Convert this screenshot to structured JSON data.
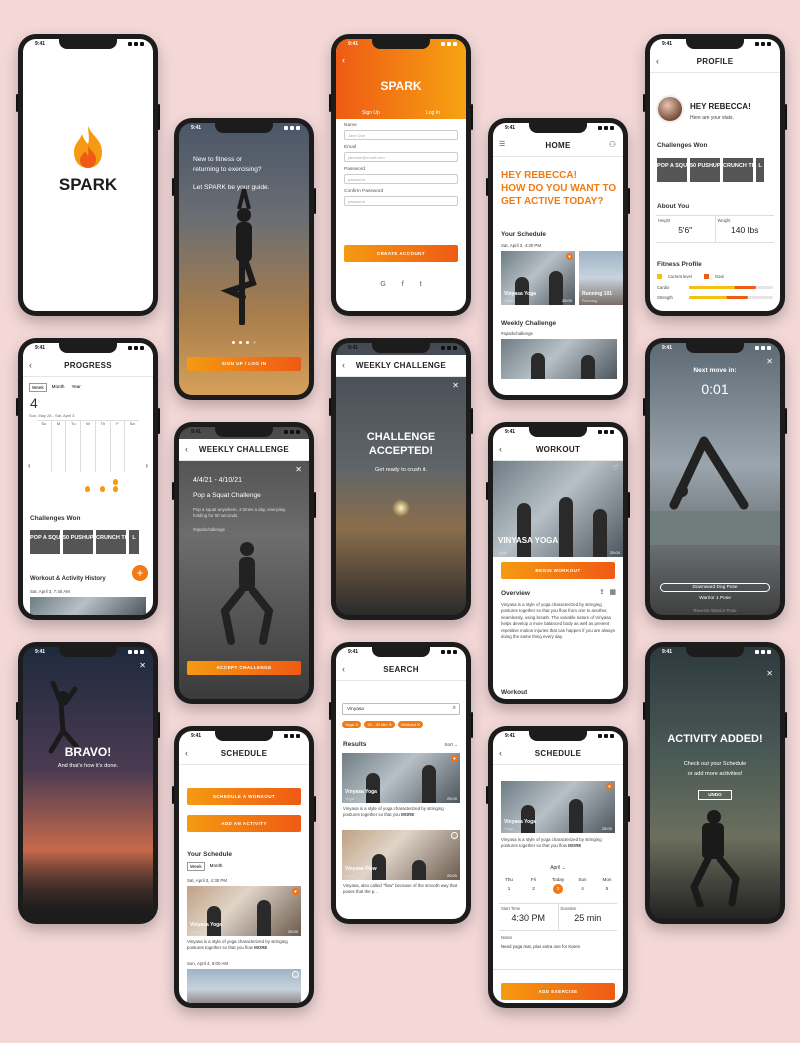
{
  "status_time": "9:41",
  "brand": "SPARK",
  "screens": {
    "splash": {
      "logo": "SPARK"
    },
    "onboarding": {
      "headline1": "New to fitness or",
      "headline2": "returning to exercising?",
      "headline3": "Let SPARK be your guide.",
      "button": "SIGN UP / LOG IN"
    },
    "signup": {
      "title": "SPARK",
      "tab_signup": "Sign Up",
      "tab_login": "Log In",
      "fields": [
        {
          "label": "Name",
          "placeholder": "Jane Doe"
        },
        {
          "label": "Email",
          "placeholder": "janedoe@email.com"
        },
        {
          "label": "Password",
          "placeholder": "password"
        },
        {
          "label": "Confirm Password",
          "placeholder": "password"
        }
      ],
      "button": "CREATE ACCOUNT",
      "social": [
        "G",
        "f",
        "t"
      ]
    },
    "home": {
      "nav_title": "HOME",
      "greeting1": "HEY REBECCA!",
      "greeting2": "HOW DO YOU WANT TO",
      "greeting3": "GET ACTIVE TODAY?",
      "schedule_heading": "Your Schedule",
      "schedule_date": "Sat, April 3, 4:30 PM",
      "card1_title": "Vinyasa Yoga",
      "card1_sub": "Yoga",
      "card1_time": "25:00",
      "card2_title": "Running 101",
      "card2_sub": "Running",
      "weekly_heading": "Weekly Challenge",
      "weekly_tag": "#sparkchallenge"
    },
    "profile": {
      "nav_title": "PROFILE",
      "greeting": "HEY REBECCA!",
      "sub": "Here are your stats.",
      "challenges_heading": "Challenges Won",
      "tiles": [
        "POP A SQUAT",
        "50 PUSHUPS",
        "CRUNCH TIME",
        "L"
      ],
      "about_heading": "About You",
      "height_label": "Height",
      "height_value": "5'6\"",
      "weight_label": "Weight",
      "weight_value": "140 lbs",
      "fitness_heading": "Fitness Profile",
      "legend_current": "Current level",
      "legend_goal": "Goal",
      "bars": [
        {
          "label": "Cardio",
          "current": 0.55,
          "goal": 0.8
        },
        {
          "label": "Strength",
          "current": 0.45,
          "goal": 0.7
        }
      ]
    },
    "progress": {
      "nav_title": "PROGRESS",
      "tabs": [
        "Week",
        "Month",
        "Year"
      ],
      "big_number": "4",
      "range": "Sun, May 28 - Sat, April 3",
      "days": [
        "Su",
        "M",
        "Tu",
        "W",
        "Th",
        "F",
        "Sa"
      ],
      "challenges_heading": "Challenges Won",
      "tiles": [
        "POP A SQUAT",
        "50 PUSHUPS",
        "CRUNCH TIME",
        "L"
      ],
      "history_heading": "Workout & Activity History",
      "history_date": "Sat, April 3, 7:45 AM"
    },
    "weekly_challenge_detail": {
      "nav_title": "WEEKLY CHALLENGE",
      "dates": "4/4/21 - 4/10/21",
      "title": "Pop a Squat Challenge",
      "desc": "Pop a squat anywhere, 3 times a day, everyday, holding for 60 seconds.",
      "tag": "#sparkchallenge",
      "button": "ACCEPT CHALLENGE"
    },
    "challenge_accepted": {
      "nav_title": "WEEKLY CHALLENGE",
      "line1": "CHALLENGE",
      "line2": "ACCEPTED!",
      "sub": "Get ready to crush it."
    },
    "workout": {
      "nav_title": "WORKOUT",
      "title": "VINYASA YOGA",
      "sub": "Yoga",
      "time": "25:00",
      "button": "BEGIN WORKOUT",
      "overview_heading": "Overview",
      "overview": "Vinyasa is a style of yoga characterized by stringing postures together so that you flow from one to another, seamlessly, using breath. The variable nature of Vinyasa helps develop a more balanced body as well as prevent repetitive motion injuries that can happen if you are always doing the same thing every day.",
      "workout_heading": "Workout"
    },
    "timer": {
      "label": "Next move in:",
      "time": "0:01",
      "current_pose": "Downward Dog Pose",
      "next_pose": "Warrior 1 Pose",
      "after_pose": "Reverse Warrior Pose"
    },
    "bravo": {
      "title": "BRAVO!",
      "sub": "And that's how it's done."
    },
    "schedule_main": {
      "nav_title": "SCHEDULE",
      "btn_schedule": "SCHEDULE A WORKOUT",
      "btn_add": "ADD AN ACTIVITY",
      "heading": "Your Schedule",
      "tabs": [
        "Week",
        "Month"
      ],
      "date1": "Sat, April 3, 4:30 PM",
      "card_title": "Vinyasa Yoga",
      "card_sub": "Yoga",
      "card_time": "25:00",
      "card_desc": "Vinyasa is a style of yoga characterized by stringing postures together so that you flow",
      "more": "MORE",
      "date2": "Sun, April 4, 9:00 AM"
    },
    "search": {
      "nav_title": "SEARCH",
      "query": "Vinyasa",
      "chips": [
        "Yoga",
        "20 - 30 Min",
        "Workout"
      ],
      "results_heading": "Results",
      "sort": "Sort",
      "results": [
        {
          "title": "Vinyasa Yoga",
          "sub": "Yoga",
          "time": "25:00",
          "desc": "Vinyasa is a style of yoga characterized by stringing postures together so that you"
        },
        {
          "title": "Vinyasa Flow",
          "sub": "Yoga",
          "time": "20:00",
          "desc": "Vinyasa, also called \"flow\" because of the smooth way that poses that the p..."
        }
      ],
      "more": "MORE"
    },
    "schedule_add": {
      "nav_title": "SCHEDULE",
      "card_title": "Vinyasa Yoga",
      "card_sub": "Yoga",
      "card_time": "25:00",
      "card_desc": "Vinyasa is a style of yoga characterized by stringing postures together so that you flow",
      "more": "MORE",
      "month": "April",
      "days": [
        {
          "d": "Thu",
          "n": "1"
        },
        {
          "d": "Fri",
          "n": "2"
        },
        {
          "d": "Today",
          "n": "3"
        },
        {
          "d": "Sun",
          "n": "4"
        },
        {
          "d": "Mon",
          "n": "5"
        }
      ],
      "start_label": "Start Time",
      "start_value": "4:30 PM",
      "duration_label": "Duration",
      "duration_value": "25 min",
      "notes_label": "Notes",
      "notes_value": "Need yoga mat, plus extra one for Karen",
      "button": "ADD EXERCISE"
    },
    "activity_added": {
      "title": "ACTIVITY ADDED!",
      "sub1": "Check out your Schedule",
      "sub2": "or add more activities!",
      "undo": "UNDO"
    }
  }
}
